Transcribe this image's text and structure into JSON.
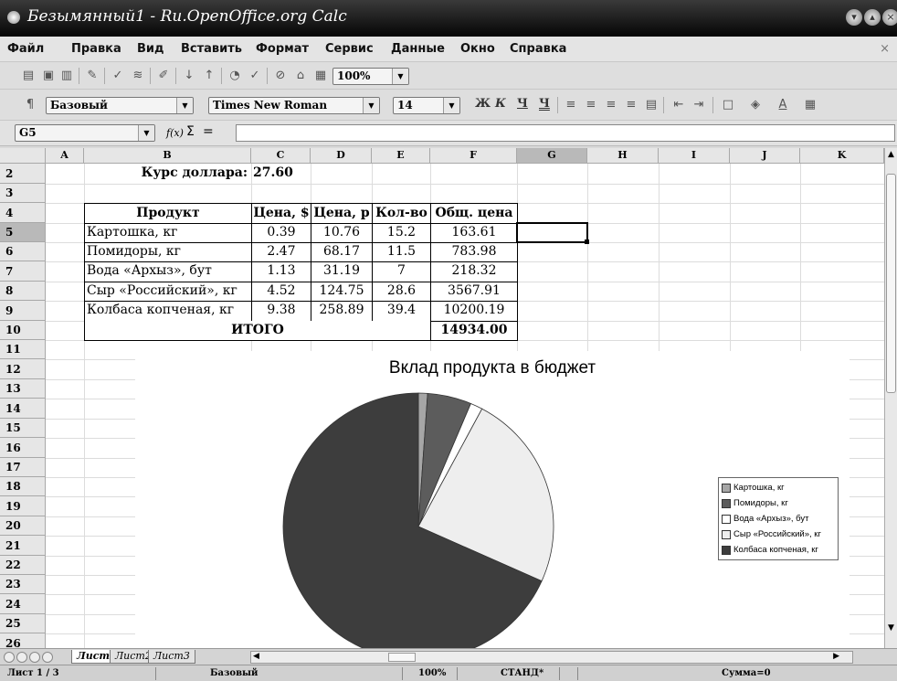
{
  "window": {
    "title": "Безымянный1 - Ru.OpenOffice.org Calc"
  },
  "menu": [
    "Файл",
    "Правка",
    "Вид",
    "Вставить",
    "Формат",
    "Сервис",
    "Данные",
    "Окно",
    "Справка"
  ],
  "toolbar": {
    "zoom": "100%"
  },
  "formatting": {
    "style": "Базовый",
    "font": "Times New Roman",
    "size": "14",
    "bold": "Ж",
    "italic": "К",
    "underline": "Ч",
    "double_underline": "Ч"
  },
  "formula_bar": {
    "cell_ref": "G5",
    "fx": "f(x)",
    "sum": "Σ",
    "eq": "=",
    "value": ""
  },
  "columns": [
    "A",
    "B",
    "C",
    "D",
    "E",
    "F",
    "G",
    "H",
    "I",
    "J",
    "K"
  ],
  "rows": [
    "2",
    "3",
    "4",
    "5",
    "6",
    "7",
    "8",
    "9",
    "10",
    "11",
    "12",
    "13",
    "14",
    "15",
    "16",
    "17",
    "18",
    "19",
    "20",
    "21",
    "22",
    "23",
    "24",
    "25",
    "26"
  ],
  "sheet": {
    "rate_label": "Курс доллара:",
    "rate_value": "27.60",
    "headers": [
      "Продукт",
      "Цена, $",
      "Цена, р",
      "Кол-во",
      "Общ. цена"
    ],
    "data": [
      [
        "Картошка, кг",
        "0.39",
        "10.76",
        "15.2",
        "163.61"
      ],
      [
        "Помидоры, кг",
        "2.47",
        "68.17",
        "11.5",
        "783.98"
      ],
      [
        "Вода «Архыз», бут",
        "1.13",
        "31.19",
        "7",
        "218.32"
      ],
      [
        "Сыр «Российский», кг",
        "4.52",
        "124.75",
        "28.6",
        "3567.91"
      ],
      [
        "Колбаса копченая, кг",
        "9.38",
        "258.89",
        "39.4",
        "10200.19"
      ]
    ],
    "total_label": "ИТОГО",
    "total_value": "14934.00"
  },
  "chart_data": {
    "type": "pie",
    "title": "Вклад продукта в бюджет",
    "categories": [
      "Картошка, кг",
      "Помидоры, кг",
      "Вода «Архыз», бут",
      "Сыр «Российский», кг",
      "Колбаса копченая, кг"
    ],
    "values": [
      163.61,
      783.98,
      218.32,
      3567.91,
      10200.19
    ],
    "colors": [
      "#a6a6a6",
      "#5c5c5c",
      "#ffffff",
      "#eeeeee",
      "#3d3d3d"
    ],
    "legend": "right"
  },
  "sheet_tabs": [
    "Лист1",
    "Лист2",
    "Лист3"
  ],
  "status": {
    "page": "Лист 1 / 3",
    "style": "Базовый",
    "zoom": "100%",
    "mode": "СТАНД",
    "modified": "*",
    "sum": "Сумма=0"
  }
}
